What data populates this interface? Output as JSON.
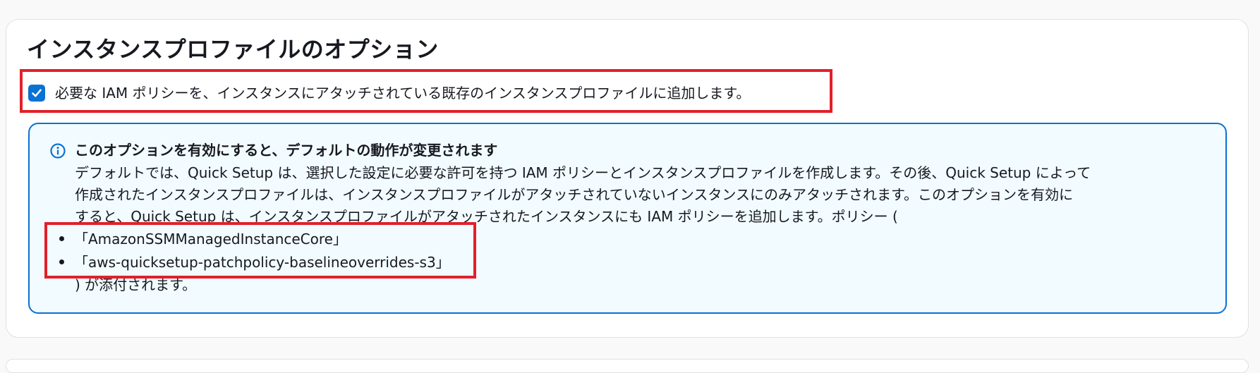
{
  "section": {
    "title": "インスタンスプロファイルのオプション"
  },
  "checkbox": {
    "checked": true,
    "label": "必要な IAM ポリシーを、インスタンスにアタッチされている既存のインスタンスプロファイルに追加します。"
  },
  "alert": {
    "type": "info",
    "icon": "info-icon",
    "header": "このオプションを有効にすると、デフォルトの動作が変更されます",
    "lines": [
      "デフォルトでは、Quick Setup は、選択した設定に必要な許可を持つ IAM ポリシーとインスタンスプロファイルを作成します。その後、Quick Setup によって",
      "作成されたインスタンスプロファイルは、インスタンスプロファイルがアタッチされていないインスタンスにのみアタッチされます。このオプションを有効に",
      "すると、Quick Setup は、インスタンスプロファイルがアタッチされたインスタンスにも IAM ポリシーを追加します。ポリシー ("
    ],
    "policies": [
      "「AmazonSSMManagedInstanceCore」",
      "「aws-quicksetup-patchpolicy-baselineoverrides-s3」"
    ],
    "closing": ") が添付されます。"
  },
  "colors": {
    "accent": "#0972d3",
    "alert_background": "#f2fbff",
    "highlight": "#e1202a"
  }
}
